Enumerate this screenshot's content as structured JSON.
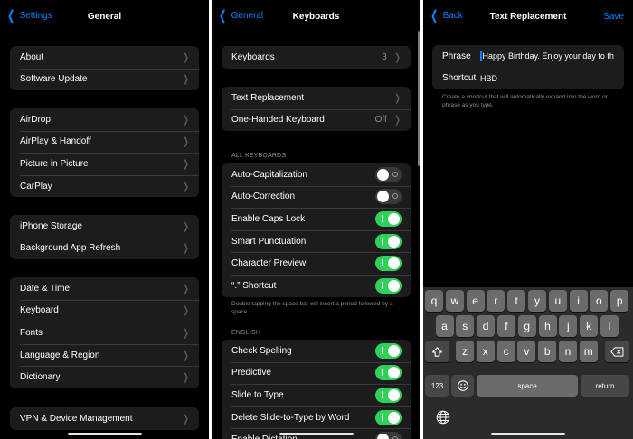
{
  "panel1": {
    "back": "Settings",
    "title": "General",
    "groups": [
      [
        "About",
        "Software Update"
      ],
      [
        "AirDrop",
        "AirPlay & Handoff",
        "Picture in Picture",
        "CarPlay"
      ],
      [
        "iPhone Storage",
        "Background App Refresh"
      ],
      [
        "Date & Time",
        "Keyboard",
        "Fonts",
        "Language & Region",
        "Dictionary"
      ],
      [
        "VPN & Device Management"
      ]
    ]
  },
  "panel2": {
    "back": "General",
    "title": "Keyboards",
    "keyboards": {
      "label": "Keyboards",
      "value": "3"
    },
    "text_replacement": "Text Replacement",
    "one_handed": {
      "label": "One-Handed Keyboard",
      "value": "Off"
    },
    "all_keyboards_header": "ALL KEYBOARDS",
    "all_keyboards": [
      {
        "label": "Auto-Capitalization",
        "on": false
      },
      {
        "label": "Auto-Correction",
        "on": false
      },
      {
        "label": "Enable Caps Lock",
        "on": true
      },
      {
        "label": "Smart Punctuation",
        "on": true
      },
      {
        "label": "Character Preview",
        "on": true
      },
      {
        "label": "“.” Shortcut",
        "on": true
      }
    ],
    "shortcut_note": "Double tapping the space bar will insert a period followed by a space.",
    "english_header": "ENGLISH",
    "english": [
      {
        "label": "Check Spelling",
        "on": true
      },
      {
        "label": "Predictive",
        "on": true
      },
      {
        "label": "Slide to Type",
        "on": true
      },
      {
        "label": "Delete Slide-to-Type by Word",
        "on": true
      },
      {
        "label": "Enable Dictation",
        "on": false
      }
    ]
  },
  "panel3": {
    "back": "Back",
    "title": "Text Replacement",
    "save": "Save",
    "phrase_label": "Phrase",
    "phrase_value": "Happy Birthday. Enjoy your day to th",
    "shortcut_label": "Shortcut",
    "shortcut_value": "HBD",
    "note": "Create a shortcut that will automatically expand into the word or phrase as you type.",
    "keyboard": {
      "row1": [
        "q",
        "w",
        "e",
        "r",
        "t",
        "y",
        "u",
        "i",
        "o",
        "p"
      ],
      "row2": [
        "a",
        "s",
        "d",
        "f",
        "g",
        "h",
        "j",
        "k",
        "l"
      ],
      "row3": [
        "z",
        "x",
        "c",
        "v",
        "b",
        "n",
        "m"
      ],
      "numbers": "123",
      "space": "space",
      "return": "return"
    }
  },
  "colors": {
    "accent": "#0a84ff",
    "toggle_on": "#30d158",
    "cell": "#1c1c1e",
    "background": "#000000"
  }
}
